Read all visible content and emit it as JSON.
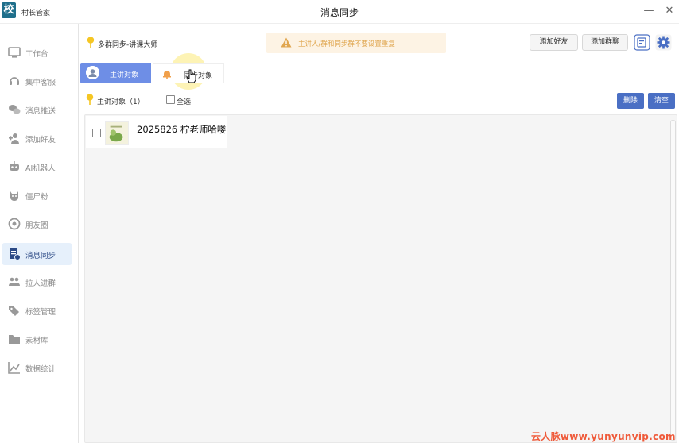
{
  "app": {
    "logo_char": "校",
    "name": "村长管家",
    "window_title": "消息同步",
    "minimize_glyph": "—",
    "close_glyph": "✕"
  },
  "sidebar": {
    "items": [
      {
        "label": "工作台",
        "icon": "desktop-icon"
      },
      {
        "label": "集中客服",
        "icon": "headset-icon"
      },
      {
        "label": "消息推送",
        "icon": "chat-icon"
      },
      {
        "label": "添加好友",
        "icon": "add-user-icon"
      },
      {
        "label": "AI机器人",
        "icon": "robot-icon"
      },
      {
        "label": "僵尸粉",
        "icon": "zombie-icon"
      },
      {
        "label": "朋友圈",
        "icon": "aperture-icon"
      },
      {
        "label": "消息同步",
        "icon": "sync-doc-icon",
        "active": true
      },
      {
        "label": "拉人进群",
        "icon": "group-icon"
      },
      {
        "label": "标签管理",
        "icon": "tag-icon"
      },
      {
        "label": "素材库",
        "icon": "folder-icon"
      },
      {
        "label": "数据统计",
        "icon": "chart-icon"
      }
    ]
  },
  "header": {
    "breadcrumb": "多群同步-讲课大师",
    "warning": "主讲人/群和同步群不要设置重复",
    "add_friend_label": "添加好友",
    "add_group_label": "添加群聊"
  },
  "tabs": {
    "main_label": "主讲对象",
    "sync_label": "同步对象"
  },
  "list_header": {
    "count_label": "主讲对象（1）",
    "select_all_label": "全选",
    "delete_label": "删除",
    "clear_label": "清空"
  },
  "list": {
    "items": [
      {
        "title": "2025826 柠老师哈喽",
        "checked": false
      }
    ]
  },
  "watermark": "云人脉www.yunyunvip.com",
  "colors": {
    "accent": "#6e8ee6",
    "primary_button": "#4a6fc4",
    "warning_text": "#e0a64f",
    "warning_bg": "#fdf3e4",
    "active_nav_bg": "#e6f0fb"
  }
}
